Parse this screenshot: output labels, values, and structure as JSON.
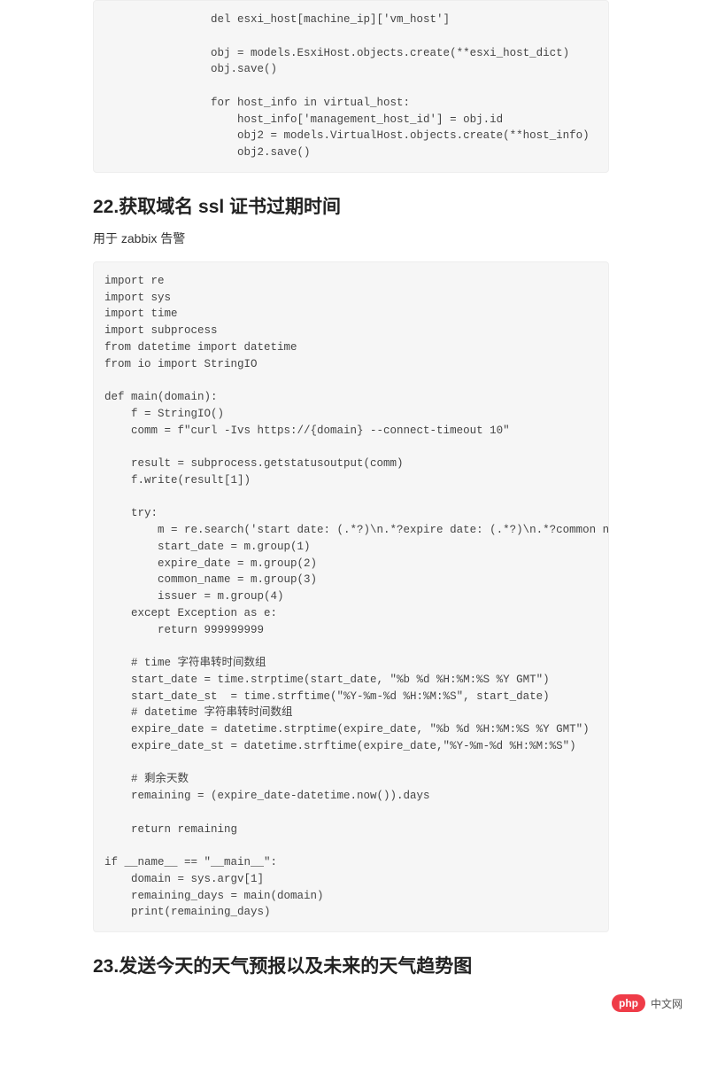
{
  "code_block_1": "                del esxi_host[machine_ip]['vm_host']\n\n                obj = models.EsxiHost.objects.create(**esxi_host_dict)\n                obj.save()\n\n                for host_info in virtual_host:\n                    host_info['management_host_id'] = obj.id\n                    obj2 = models.VirtualHost.objects.create(**host_info)\n                    obj2.save()",
  "heading_1": "22.获取域名 ssl 证书过期时间",
  "paragraph_1": "用于 zabbix 告警",
  "code_block_2": "import re\nimport sys\nimport time\nimport subprocess\nfrom datetime import datetime\nfrom io import StringIO\n\ndef main(domain):\n    f = StringIO()\n    comm = f\"curl -Ivs https://{domain} --connect-timeout 10\"\n\n    result = subprocess.getstatusoutput(comm)\n    f.write(result[1])\n\n    try:\n        m = re.search('start date: (.*?)\\n.*?expire date: (.*?)\\n.*?common name: (.*?)\\n.*?issuer: CN=(.*?)\\n', f.getvalue(), re.S)\n        start_date = m.group(1)\n        expire_date = m.group(2)\n        common_name = m.group(3)\n        issuer = m.group(4)\n    except Exception as e:\n        return 999999999\n\n    # time 字符串转时间数组\n    start_date = time.strptime(start_date, \"%b %d %H:%M:%S %Y GMT\")\n    start_date_st  = time.strftime(\"%Y-%m-%d %H:%M:%S\", start_date)\n    # datetime 字符串转时间数组\n    expire_date = datetime.strptime(expire_date, \"%b %d %H:%M:%S %Y GMT\")\n    expire_date_st = datetime.strftime(expire_date,\"%Y-%m-%d %H:%M:%S\")\n\n    # 剩余天数\n    remaining = (expire_date-datetime.now()).days\n\n    return remaining\n\nif __name__ == \"__main__\":\n    domain = sys.argv[1]\n    remaining_days = main(domain)\n    print(remaining_days)",
  "heading_2": "23.发送今天的天气预报以及未来的天气趋势图",
  "watermark": {
    "pill": "php",
    "text": "中文网"
  }
}
